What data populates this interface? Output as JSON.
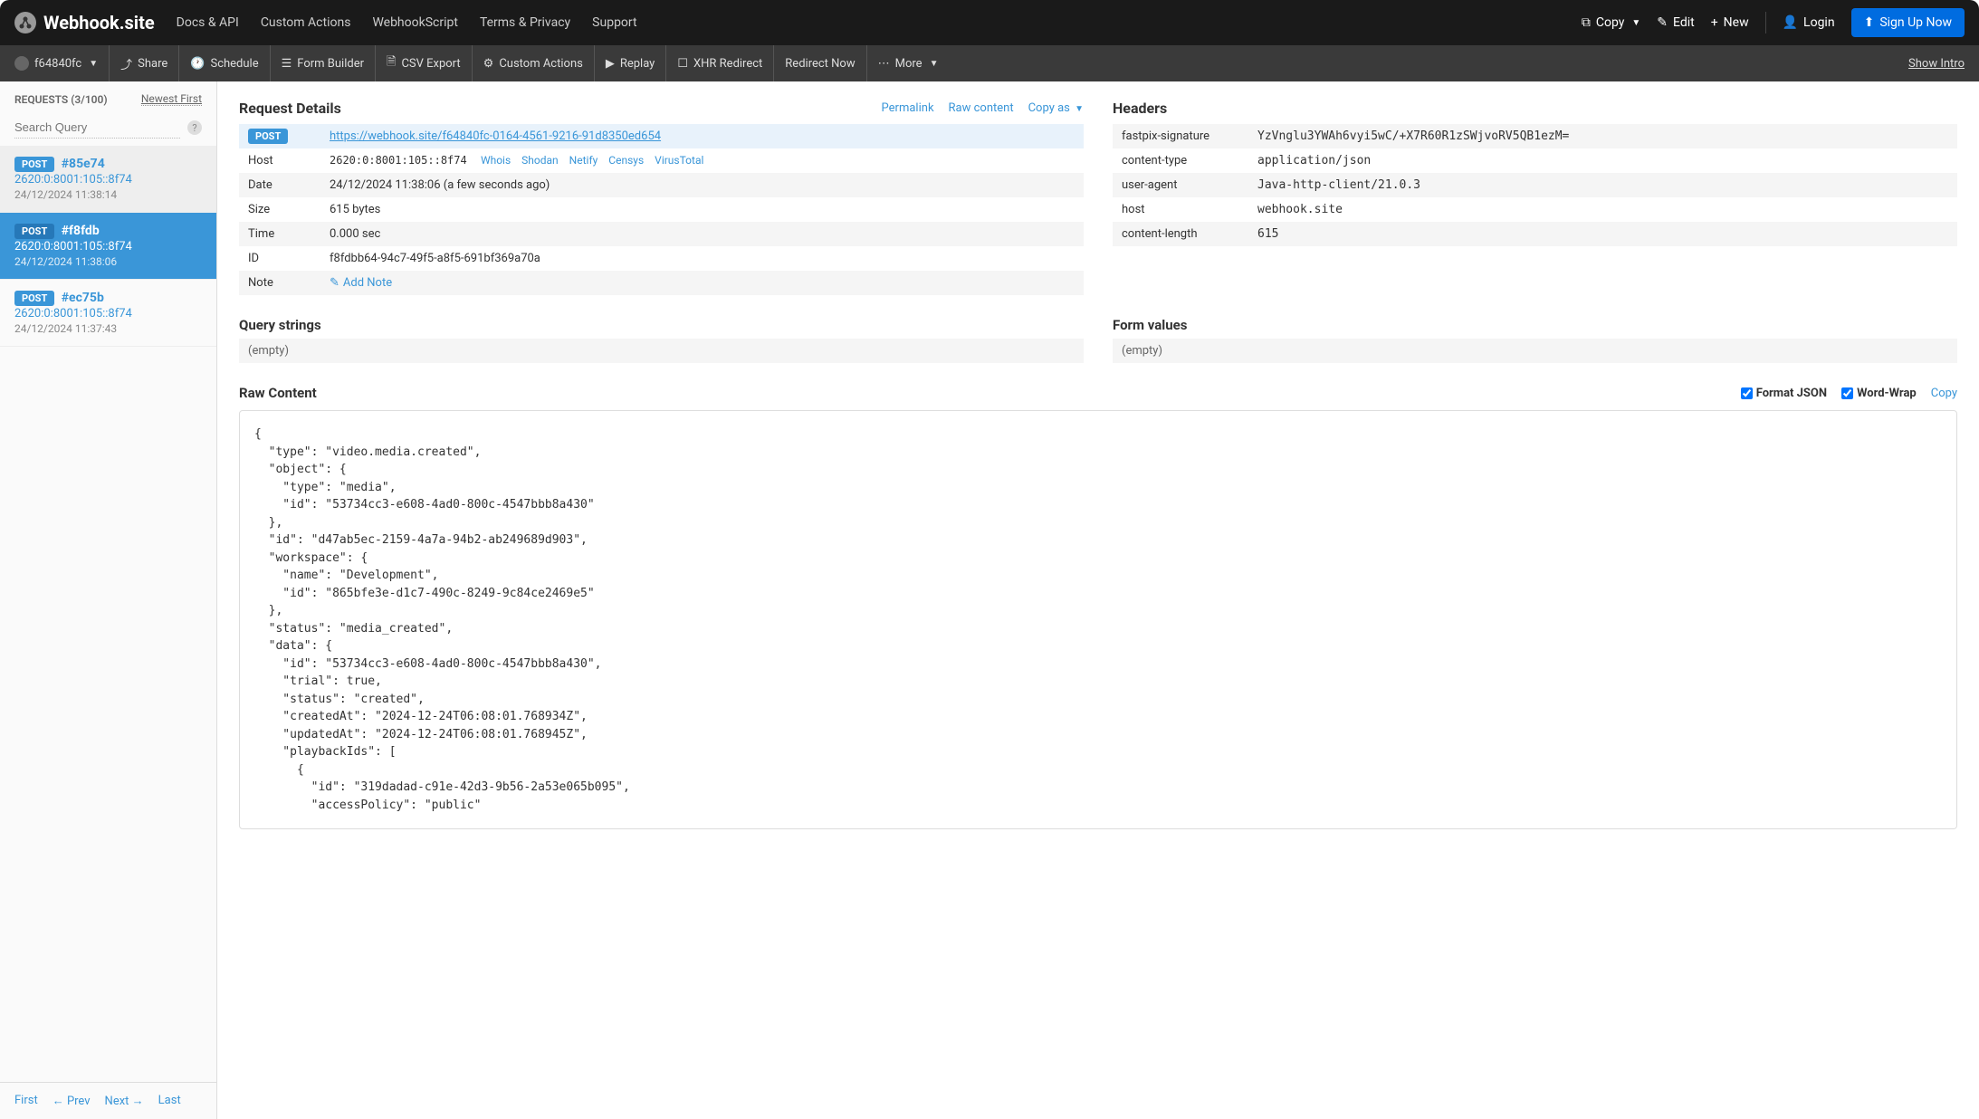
{
  "brand": "Webhook.site",
  "topnav": {
    "docs": "Docs & API",
    "custom_actions": "Custom Actions",
    "webhookscript": "WebhookScript",
    "terms": "Terms & Privacy",
    "support": "Support"
  },
  "topright": {
    "copy": "Copy",
    "edit": "Edit",
    "new": "New",
    "login": "Login",
    "signup": "Sign Up Now"
  },
  "toolbar": {
    "token": "f64840fc",
    "share": "Share",
    "schedule": "Schedule",
    "form_builder": "Form Builder",
    "csv_export": "CSV Export",
    "custom_actions": "Custom Actions",
    "replay": "Replay",
    "xhr_redirect": "XHR Redirect",
    "redirect_now": "Redirect Now",
    "more": "More",
    "show_intro": "Show Intro"
  },
  "sidebar": {
    "requests_label": "REQUESTS (3/100)",
    "newest_first": "Newest First",
    "search_placeholder": "Search Query",
    "items": [
      {
        "method": "POST",
        "hash": "#85e74",
        "host": "2620:0:8001:105::8f74",
        "date": "24/12/2024 11:38:14"
      },
      {
        "method": "POST",
        "hash": "#f8fdb",
        "host": "2620:0:8001:105::8f74",
        "date": "24/12/2024 11:38:06"
      },
      {
        "method": "POST",
        "hash": "#ec75b",
        "host": "2620:0:8001:105::8f74",
        "date": "24/12/2024 11:37:43"
      }
    ],
    "pager": {
      "first": "First",
      "prev": "← Prev",
      "next": "Next →",
      "last": "Last"
    }
  },
  "details": {
    "title": "Request Details",
    "actions": {
      "permalink": "Permalink",
      "raw_content": "Raw content",
      "copy_as": "Copy as"
    },
    "url_method": "POST",
    "url": "https://webhook.site/f64840fc-0164-4561-9216-91d8350ed654",
    "labels": {
      "host": "Host",
      "date": "Date",
      "size": "Size",
      "time": "Time",
      "id": "ID",
      "note": "Note"
    },
    "host": "2620:0:8001:105::8f74",
    "host_links": {
      "whois": "Whois",
      "shodan": "Shodan",
      "netify": "Netify",
      "censys": "Censys",
      "virustotal": "VirusTotal"
    },
    "date": "24/12/2024 11:38:06 (a few seconds ago)",
    "size": "615 bytes",
    "time": "0.000 sec",
    "id": "f8fdbb64-94c7-49f5-a8f5-691bf369a70a",
    "add_note": "Add Note"
  },
  "headers": {
    "title": "Headers",
    "rows": [
      {
        "key": "fastpix-signature",
        "val": "YzVnglu3YWAh6vyi5wC/+X7R60R1zSWjvoRV5QB1ezM="
      },
      {
        "key": "content-type",
        "val": "application/json"
      },
      {
        "key": "user-agent",
        "val": "Java-http-client/21.0.3"
      },
      {
        "key": "host",
        "val": "webhook.site"
      },
      {
        "key": "content-length",
        "val": "615"
      }
    ]
  },
  "query_strings": {
    "title": "Query strings",
    "empty": "(empty)"
  },
  "form_values": {
    "title": "Form values",
    "empty": "(empty)"
  },
  "raw": {
    "title": "Raw Content",
    "format_json": "Format JSON",
    "word_wrap": "Word-Wrap",
    "copy": "Copy",
    "body": "{\n  \"type\": \"video.media.created\",\n  \"object\": {\n    \"type\": \"media\",\n    \"id\": \"53734cc3-e608-4ad0-800c-4547bbb8a430\"\n  },\n  \"id\": \"d47ab5ec-2159-4a7a-94b2-ab249689d903\",\n  \"workspace\": {\n    \"name\": \"Development\",\n    \"id\": \"865bfe3e-d1c7-490c-8249-9c84ce2469e5\"\n  },\n  \"status\": \"media_created\",\n  \"data\": {\n    \"id\": \"53734cc3-e608-4ad0-800c-4547bbb8a430\",\n    \"trial\": true,\n    \"status\": \"created\",\n    \"createdAt\": \"2024-12-24T06:08:01.768934Z\",\n    \"updatedAt\": \"2024-12-24T06:08:01.768945Z\",\n    \"playbackIds\": [\n      {\n        \"id\": \"319dadad-c91e-42d3-9b56-2a53e065b095\",\n        \"accessPolicy\": \"public\""
  }
}
